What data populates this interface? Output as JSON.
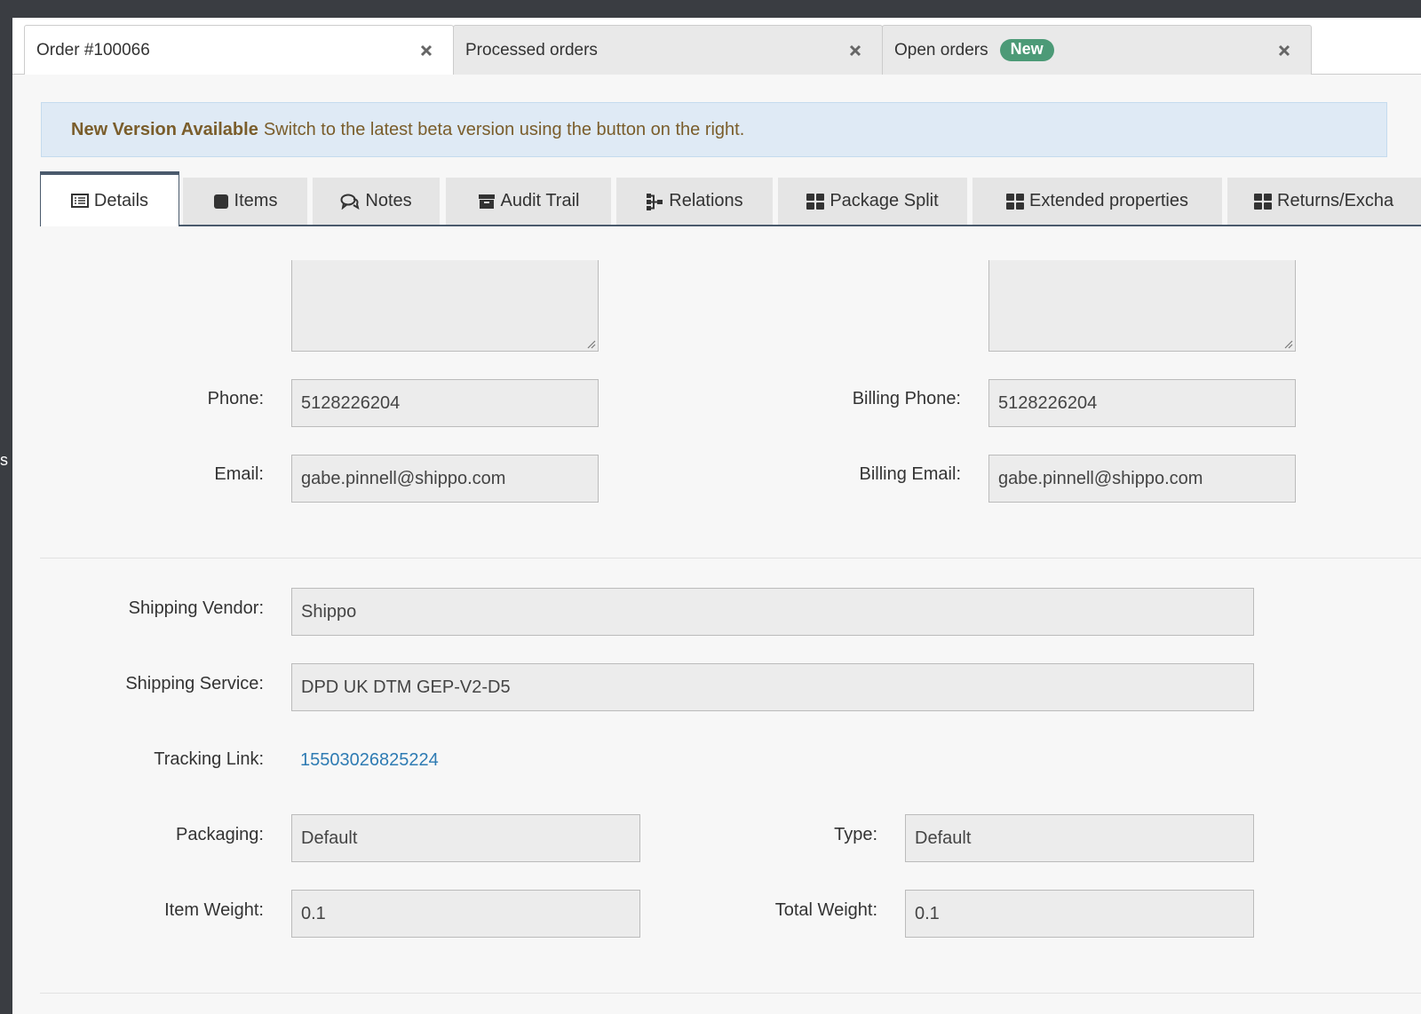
{
  "doc_tabs": [
    {
      "label": "Order #100066"
    },
    {
      "label": "Processed orders"
    },
    {
      "label": "Open orders",
      "badge": "New"
    }
  ],
  "alert": {
    "title": "New Version Available",
    "message": "Switch to the latest beta version using the button on the right."
  },
  "subtabs": [
    {
      "label": "Details",
      "icon": "list-icon"
    },
    {
      "label": "Items",
      "icon": "square-icon"
    },
    {
      "label": "Notes",
      "icon": "comments-icon"
    },
    {
      "label": "Audit Trail",
      "icon": "archive-icon"
    },
    {
      "label": "Relations",
      "icon": "sitemap-icon"
    },
    {
      "label": "Package Split",
      "icon": "grid-icon"
    },
    {
      "label": "Extended properties",
      "icon": "grid-icon"
    },
    {
      "label": "Returns/Excha",
      "icon": "grid-icon"
    }
  ],
  "contact": {
    "phone_label": "Phone:",
    "phone": "5128226204",
    "email_label": "Email:",
    "email": "gabe.pinnell@shippo.com",
    "billing_phone_label": "Billing Phone:",
    "billing_phone": "5128226204",
    "billing_email_label": "Billing Email:",
    "billing_email": "gabe.pinnell@shippo.com"
  },
  "shipping": {
    "vendor_label": "Shipping Vendor:",
    "vendor": "Shippo",
    "service_label": "Shipping Service:",
    "service": "DPD UK DTM GEP-V2-D5",
    "tracking_label": "Tracking Link:",
    "tracking": "15503026825224",
    "packaging_label": "Packaging:",
    "packaging": "Default",
    "type_label": "Type:",
    "type": "Default",
    "item_weight_label": "Item Weight:",
    "item_weight": "0.1",
    "total_weight_label": "Total Weight:",
    "total_weight": "0.1"
  },
  "sidebar_fragment": "s",
  "colors": {
    "accent": "#4a5a6c",
    "badge": "#4c9a77",
    "alert_bg": "#dfeaf5",
    "alert_text": "#7a5d2b",
    "link": "#2e7bb3"
  }
}
